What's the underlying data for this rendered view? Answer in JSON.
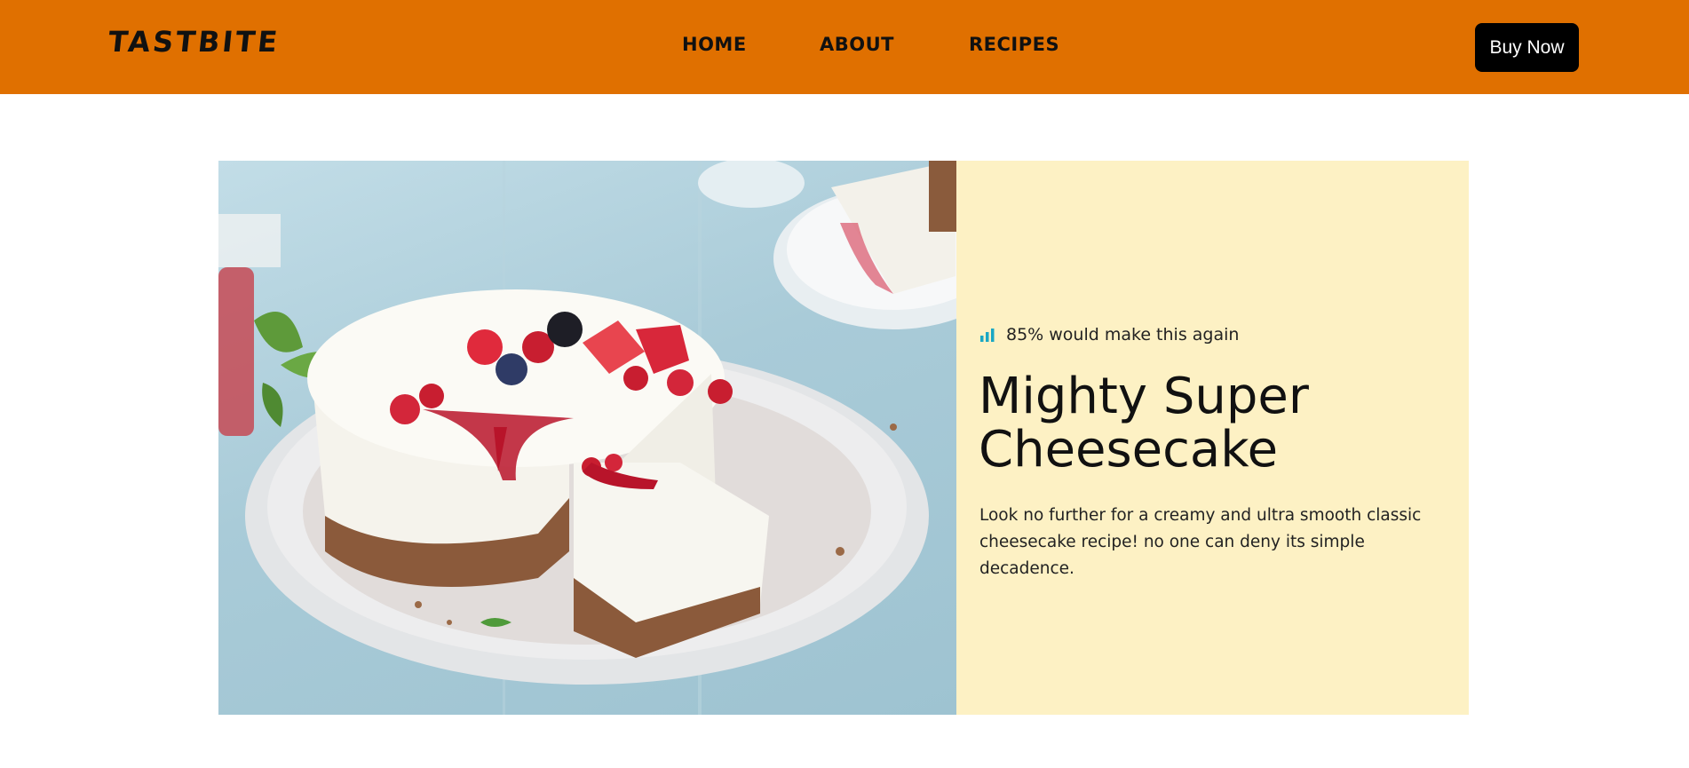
{
  "header": {
    "logo": "TASTBITE",
    "nav": [
      "HOME",
      "ABOUT",
      "RECIPES"
    ],
    "cta_label": "Buy Now",
    "background_color": "#e07000"
  },
  "hero": {
    "image_subject": "cheesecake-with-berries",
    "rating_icon": "chart-bars-icon",
    "rating_text": "85% would make this again",
    "title": "Mighty Super Cheesecake",
    "description": "Look no further for a creamy and ultra smooth classic cheesecake recipe! no one can deny its simple decadence.",
    "panel_color": "#fdf1c4"
  }
}
